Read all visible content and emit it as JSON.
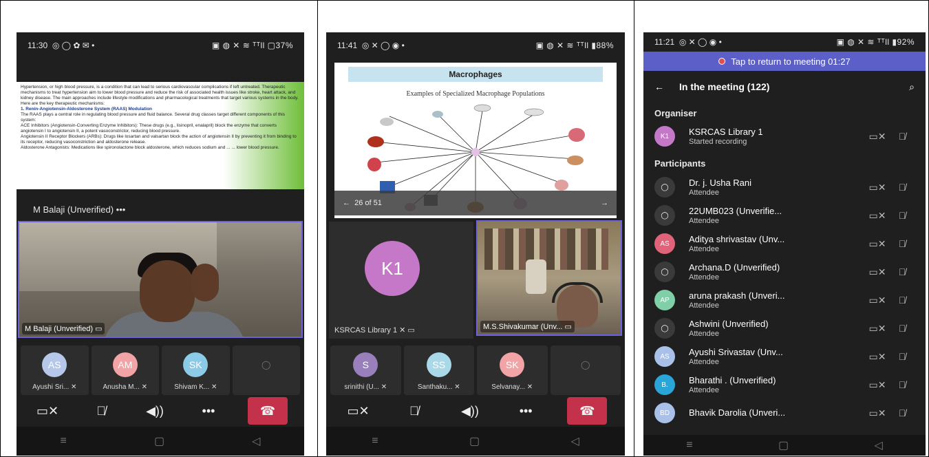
{
  "phone1": {
    "status_time": "11:30",
    "status_icons": "◎ ◯ ✿ ✉ •",
    "status_right": "▣ ◍ ✕ ≋ ᵀᵀll ▢37%",
    "slide_text": [
      {
        "cls": "",
        "text": "Hypertension, or high blood pressure, is a condition that can lead to serious cardiovascular complications if left untreated. Therapeutic mechanisms to treat hypertension aim to lower blood pressure and reduce the risk of associated health issues like stroke, heart attack, and kidney disease. The main approaches include lifestyle modifications and pharmacological treatments that target various systems in the body. Here are the key therapeutic mechanisms:"
      },
      {
        "cls": "hl",
        "text": "1. Renin-Angiotensin-Aldosterone System (RAAS) Modulation"
      },
      {
        "cls": "",
        "text": "The RAAS plays a central role in regulating blood pressure and fluid balance. Several drug classes target different components of this system:"
      },
      {
        "cls": "",
        "text": "ACE Inhibitors (Angiotensin-Converting Enzyme Inhibitors): These drugs (e.g., lisinopril, enalapril) block the enzyme that converts angiotensin I to angiotensin II, a potent vasoconstrictor, reducing blood pressure."
      },
      {
        "cls": "",
        "text": "Angiotensin II Receptor Blockers (ARBs): Drugs like losartan and valsartan block the action of angiotensin II by preventing it from binding to its receptor, reducing vasoconstriction and aldosterone release."
      },
      {
        "cls": "",
        "text": "Aldosterone Antagonists: Medications like spironolactone block aldosterone, which reduces sodium and ... ... lower blood pressure."
      }
    ],
    "presenter_label": "M Balaji (Unverified)  •••",
    "video_label": "M Balaji (Unverified)",
    "tiles": [
      {
        "initials": "AS",
        "name": "Ayushi Sri... ✕",
        "color": "#b5c8ea"
      },
      {
        "initials": "AM",
        "name": "Anusha M... ✕",
        "color": "#f2a3a6"
      },
      {
        "initials": "SK",
        "name": "Shivam K... ✕",
        "color": "#8ccbe8"
      },
      {
        "initials": "◯",
        "name": "",
        "color": ""
      }
    ]
  },
  "phone2": {
    "status_time": "11:41",
    "status_icons": "◎ ✕ ◯ ◉ •",
    "status_right": "▣ ◍ ✕ ≋ ᵀᵀll ▮88%",
    "slide_title": "Macrophages",
    "slide_subtitle": "Examples of Specialized Macrophage Populations",
    "slide_counter": "26 of 51",
    "self_initials": "K1",
    "self_label": "KSRCAS Library 1 ✕",
    "video_label": "M.S.Shivakumar (Unv...",
    "tiles": [
      {
        "initials": "S",
        "name": "srinithi (U... ✕",
        "color": "#9a7fbd"
      },
      {
        "initials": "SS",
        "name": "Santhaku... ✕",
        "color": "#a9d8e8"
      },
      {
        "initials": "SK",
        "name": "Selvanay... ✕",
        "color": "#f2a3a6"
      },
      {
        "initials": "◯",
        "name": "",
        "color": ""
      }
    ]
  },
  "phone3": {
    "status_time": "11:21",
    "status_icons": "◎ ✕ ◯ ◉ •",
    "status_right": "▣ ◍ ✕ ≋ ᵀᵀll ▮92%",
    "return_text": "Tap to return to meeting 01:27",
    "title": "In the meeting (122)",
    "organiser_header": "Organiser",
    "organiser": {
      "initials": "K1",
      "name": "KSRCAS Library 1",
      "role": "Started recording",
      "color": "#c678c8"
    },
    "participants_header": "Participants",
    "participants": [
      {
        "initials": "◯",
        "name": "Dr. j. Usha Rani",
        "role": "Attendee",
        "color": "#3a3a3a"
      },
      {
        "initials": "◯",
        "name": "22UMB023  (Unverifie...",
        "role": "Attendee",
        "color": "#3a3a3a"
      },
      {
        "initials": "AS",
        "name": "Aditya shrivastav (Unv...",
        "role": "Attendee",
        "color": "#e0637a"
      },
      {
        "initials": "◯",
        "name": "Archana.D (Unverified)",
        "role": "Attendee",
        "color": "#3a3a3a"
      },
      {
        "initials": "AP",
        "name": "aruna prakash (Unveri...",
        "role": "Attendee",
        "color": "#7fd0a8"
      },
      {
        "initials": "◯",
        "name": "Ashwini (Unverified)",
        "role": "Attendee",
        "color": "#3a3a3a"
      },
      {
        "initials": "AS",
        "name": "Ayushi Srivastav (Unv...",
        "role": "Attendee",
        "color": "#a9c0e8"
      },
      {
        "initials": "B.",
        "name": "Bharathi . (Unverified)",
        "role": "Attendee",
        "color": "#2aa5d8"
      },
      {
        "initials": "BD",
        "name": "Bhavik Darolia (Unveri...",
        "role": "",
        "color": "#a9c0e8"
      }
    ]
  },
  "icons": {
    "camera_off": "▭✕",
    "mic_off": "🎙̸",
    "speaker": "◀))",
    "more": "•••",
    "hangup": "☎",
    "back": "←",
    "search": "⌕",
    "nav_recent": "≡",
    "nav_home": "▢",
    "nav_back": "◁"
  }
}
